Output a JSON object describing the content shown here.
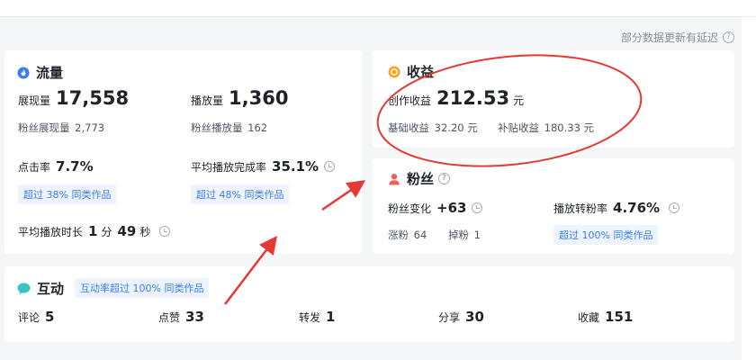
{
  "note": {
    "text": "部分数据更新有延迟",
    "icon": "question-icon"
  },
  "traffic": {
    "title": "流量",
    "icon": "flame-icon",
    "impressions": {
      "label": "展现量",
      "value": "17,558"
    },
    "plays": {
      "label": "播放量",
      "value": "1,360"
    },
    "fan_impressions": {
      "label": "粉丝展现量",
      "value": "2,773"
    },
    "fan_plays": {
      "label": "粉丝播放量",
      "value": "162"
    },
    "ctr": {
      "label": "点击率",
      "value": "7.7%",
      "tag": "超过 38% 同类作品"
    },
    "completion": {
      "label": "平均播放完成率",
      "value": "35.1%",
      "tag": "超过 48% 同类作品"
    },
    "avg_duration": {
      "label": "平均播放时长",
      "min_value": "1",
      "min_unit": "分",
      "sec_value": "49",
      "sec_unit": "秒"
    }
  },
  "income": {
    "title": "收益",
    "icon": "coin-icon",
    "creation": {
      "label": "创作收益",
      "value": "212.53",
      "unit": "元"
    },
    "base": {
      "label": "基础收益",
      "value": "32.20 元"
    },
    "bonus": {
      "label": "补贴收益",
      "value": "180.33 元"
    }
  },
  "fans": {
    "title": "粉丝",
    "icon": "person-icon",
    "change": {
      "label": "粉丝变化",
      "value": "+63"
    },
    "conversion": {
      "label": "播放转粉率",
      "value": "4.76%",
      "tag": "超过 100% 同类作品"
    },
    "gain": {
      "label": "涨粉",
      "value": "64"
    },
    "loss": {
      "label": "掉粉",
      "value": "1"
    }
  },
  "interaction": {
    "title": "互动",
    "icon": "chat-icon",
    "tag": "互动率超过 100% 同类作品",
    "comments": {
      "label": "评论",
      "value": "5"
    },
    "likes": {
      "label": "点赞",
      "value": "33"
    },
    "reposts": {
      "label": "转发",
      "value": "1"
    },
    "shares": {
      "label": "分享",
      "value": "30"
    },
    "favorites": {
      "label": "收藏",
      "value": "151"
    }
  },
  "colors": {
    "accent_blue": "#3a7cf5",
    "tag_bg": "#edf3ff",
    "annotation_red": "#e53935",
    "income_icon": "#f5a623",
    "fans_icon": "#f0605a",
    "interaction_icon": "#36c5c4"
  }
}
